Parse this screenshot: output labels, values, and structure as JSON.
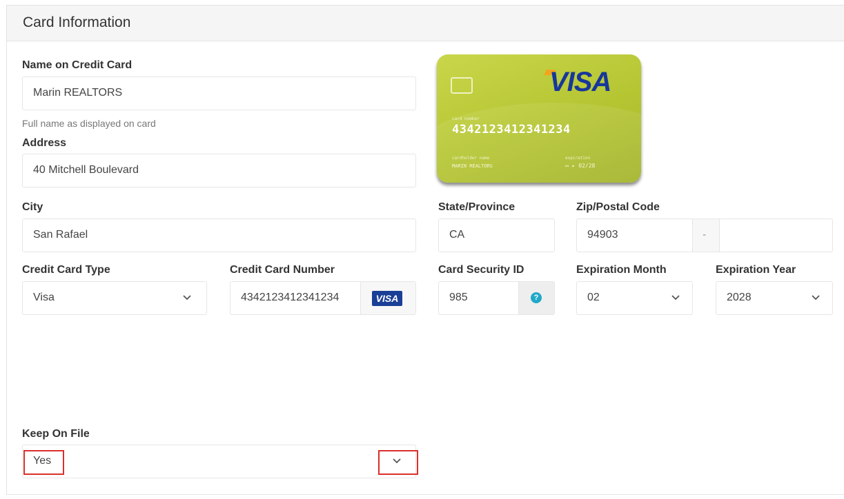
{
  "panel": {
    "title": "Card Information"
  },
  "name_on_card": {
    "label": "Name on Credit Card",
    "value": "Marin REALTORS",
    "help": "Full name as displayed on card"
  },
  "address": {
    "label": "Address",
    "value": "40 Mitchell Boulevard"
  },
  "city": {
    "label": "City",
    "value": "San Rafael"
  },
  "state": {
    "label": "State/Province",
    "value": "CA"
  },
  "zip": {
    "label": "Zip/Postal Code",
    "value": "94903",
    "separator": "-",
    "extension": ""
  },
  "card_type": {
    "label": "Credit Card Type",
    "selected": "Visa"
  },
  "card_number": {
    "label": "Credit Card Number",
    "value": "4342123412341234",
    "brand_badge": "VISA"
  },
  "security_id": {
    "label": "Card Security ID",
    "value": "985",
    "help_icon": "question-circle-icon"
  },
  "exp_month": {
    "label": "Expiration Month",
    "selected": "02"
  },
  "exp_year": {
    "label": "Expiration Year",
    "selected": "2028"
  },
  "keep_on_file": {
    "label": "Keep On File",
    "selected": "Yes"
  },
  "card_preview": {
    "brand": "VISA",
    "number_label": "card number",
    "number": "4342123412341234",
    "holder_label": "cardholder name",
    "holder": "MARIN REALTORS",
    "expiration_label": "expiration",
    "expiration": "02/28",
    "color": "#b5c532"
  },
  "colors": {
    "highlight_box": "#d9302a",
    "help_icon": "#1fa9c9",
    "visa_blue": "#1a3f96"
  }
}
